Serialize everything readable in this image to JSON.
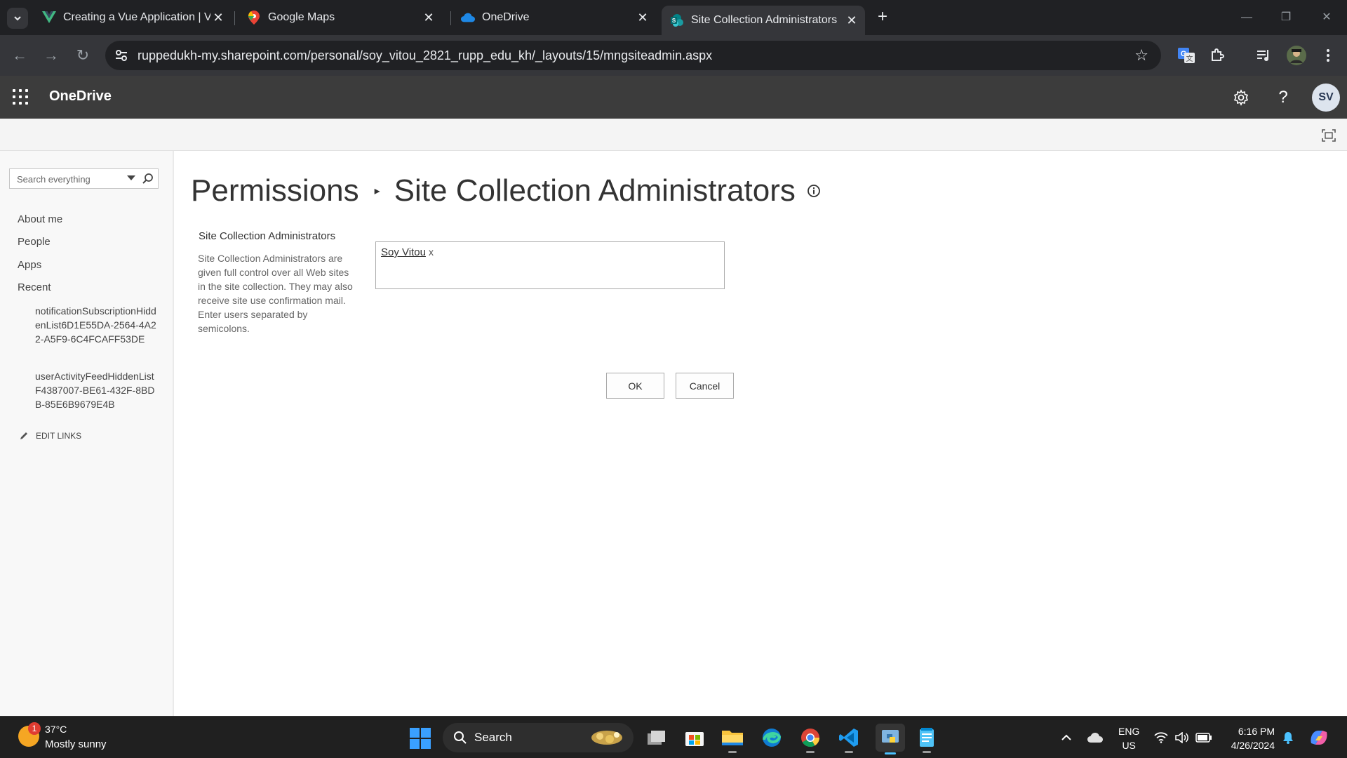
{
  "browser": {
    "tabs": [
      {
        "title": "Creating a Vue Application | Vu",
        "icon": "vue-icon"
      },
      {
        "title": "Google Maps",
        "icon": "google-maps-icon"
      },
      {
        "title": "OneDrive",
        "icon": "onedrive-icon"
      },
      {
        "title": "Site Collection Administrators",
        "icon": "sharepoint-icon",
        "active": true
      }
    ],
    "url": "ruppedukh-my.sharepoint.com/personal/soy_vitou_2821_rupp_edu_kh/_layouts/15/mngsiteadmin.aspx"
  },
  "suite": {
    "brand": "OneDrive",
    "avatar_initials": "SV"
  },
  "leftnav": {
    "search_placeholder": "Search everything",
    "links": [
      "About me",
      "People",
      "Apps",
      "Recent"
    ],
    "recent": [
      "notificationSubscriptionHiddenList6D1E55DA-2564-4A22-A5F9-6C4FCAFF53DE",
      "userActivityFeedHiddenListF4387007-BE61-432F-8BDB-85E6B9679E4B"
    ],
    "edit_links": "EDIT LINKS"
  },
  "main": {
    "breadcrumb_parent": "Permissions",
    "breadcrumb_current": "Site Collection Administrators",
    "section_title": "Site Collection Administrators",
    "section_description": "Site Collection Administrators are given full control over all Web sites in the site collection. They may also receive site use confirmation mail. Enter users separated by semicolons.",
    "admins": [
      {
        "name": "Soy Vitou",
        "remove": "x"
      }
    ],
    "ok_label": "OK",
    "cancel_label": "Cancel"
  },
  "taskbar": {
    "weather_temp": "37°C",
    "weather_condition": "Mostly sunny",
    "weather_badge": "1",
    "search_label": "Search",
    "lang_top": "ENG",
    "lang_bottom": "US",
    "time": "6:16 PM",
    "date": "4/26/2024"
  },
  "colors": {
    "chrome_dark": "#202124",
    "chrome_toolbar": "#35363a",
    "suitebar": "#3c3c3c",
    "taskbar": "#202020",
    "accent_blue": "#3aa0ff"
  }
}
